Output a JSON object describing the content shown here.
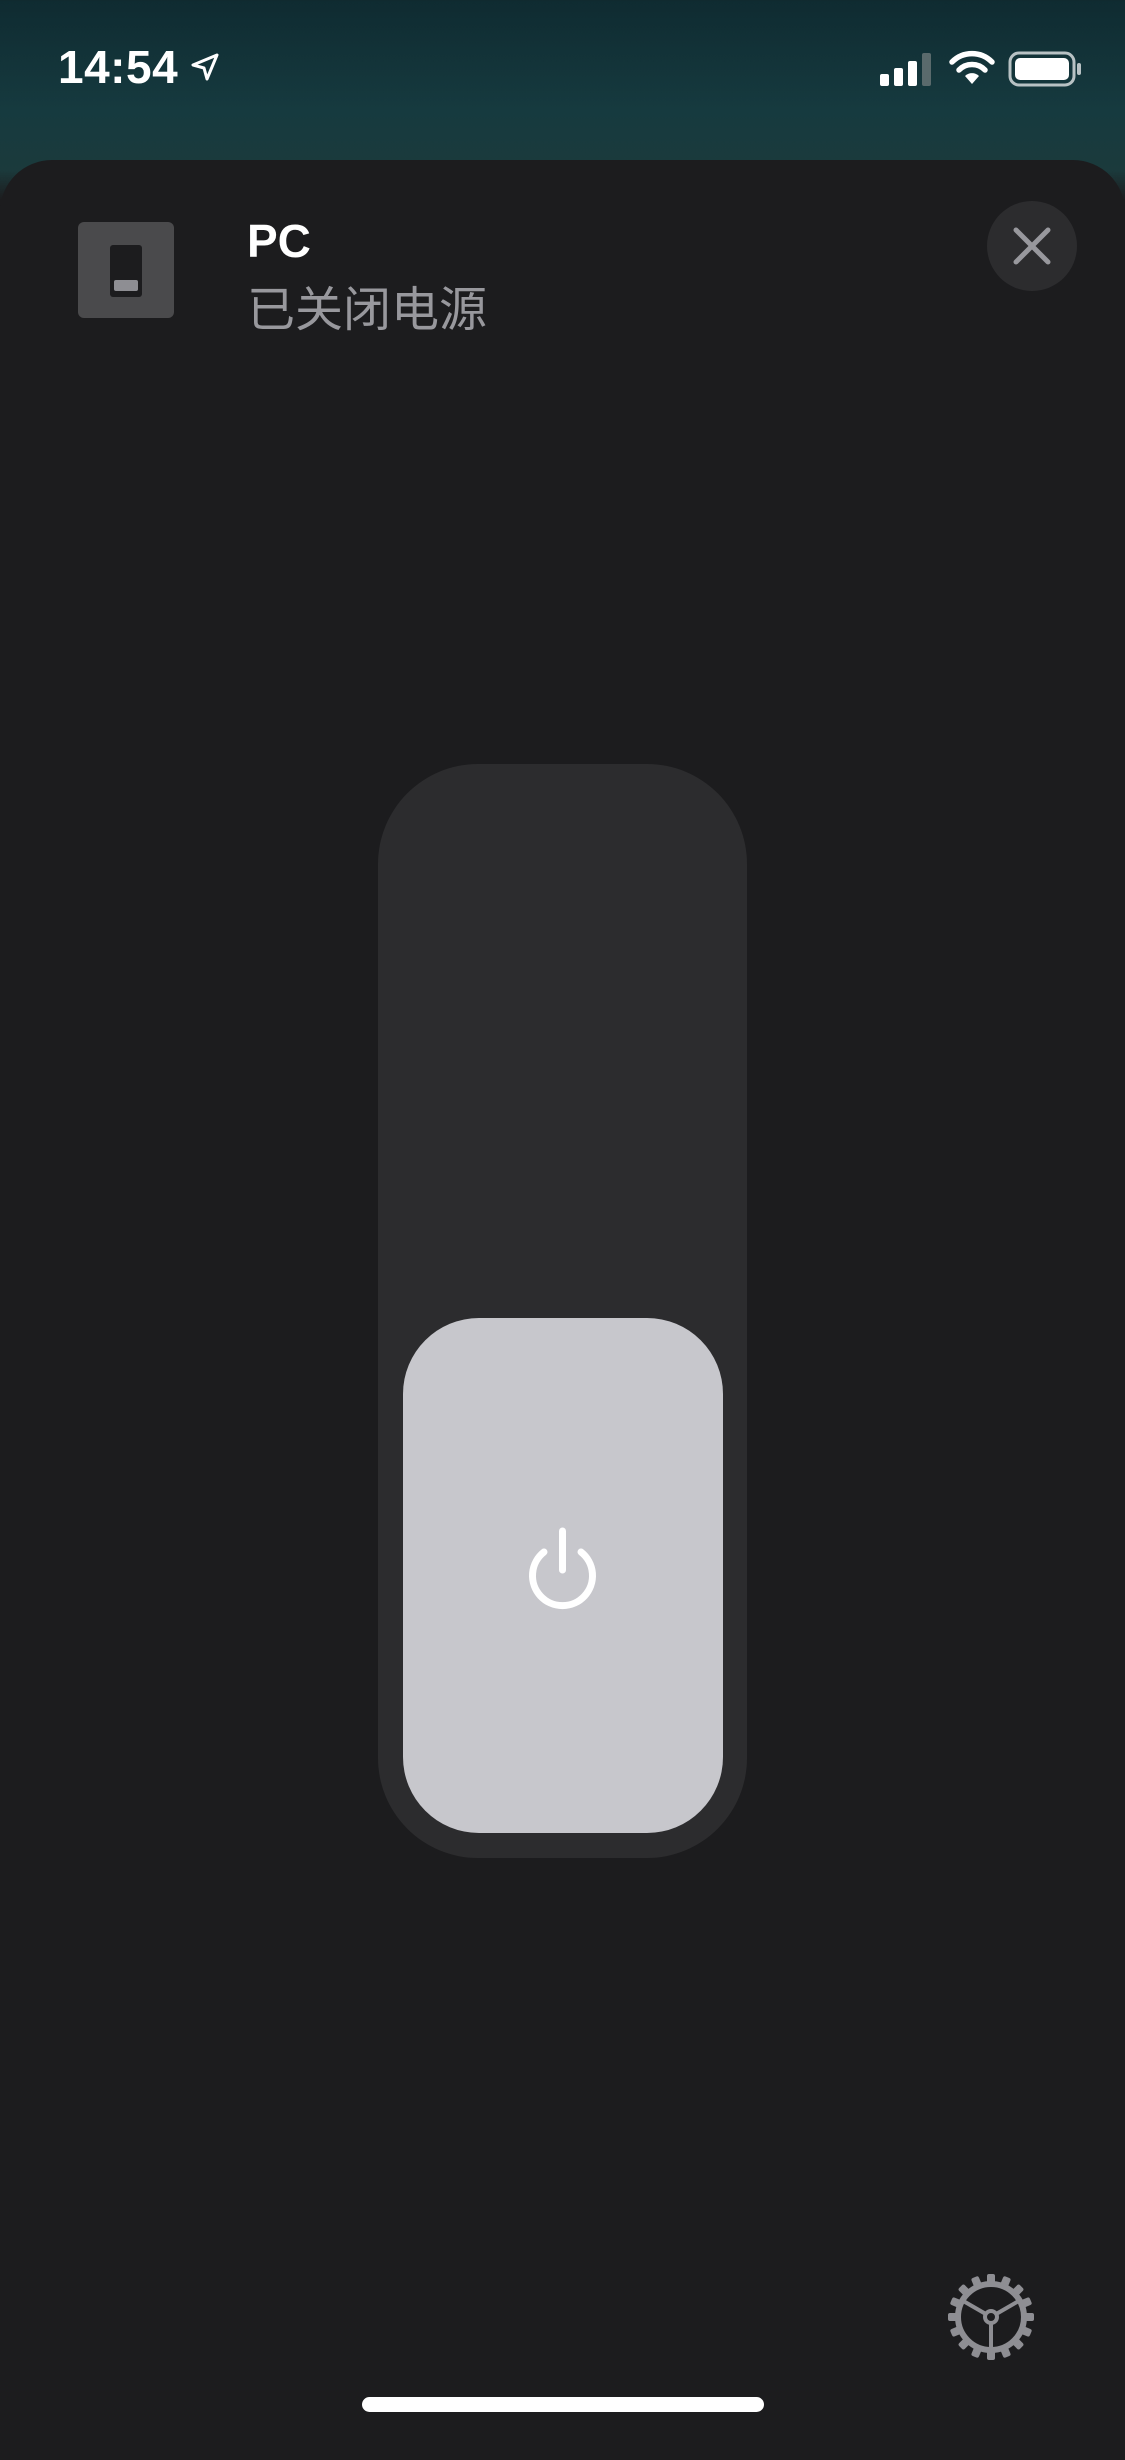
{
  "status_bar": {
    "time": "14:54",
    "icons": [
      "location-arrow-icon",
      "cellular-signal-icon",
      "wifi-icon",
      "battery-icon"
    ]
  },
  "accessory": {
    "icon": "light-switch-icon",
    "name": "PC",
    "status": "已关闭电源"
  },
  "close_icon": "close-icon",
  "power_control": {
    "icon": "power-icon",
    "level": 0.47,
    "state": "off"
  },
  "settings_icon": "gear-icon",
  "colors": {
    "background": "#1c1c1e",
    "track": "#2c2c2e",
    "fill": "#c7c7cc",
    "secondary_text": "#98989d",
    "top_gradient": "#163a3f"
  }
}
